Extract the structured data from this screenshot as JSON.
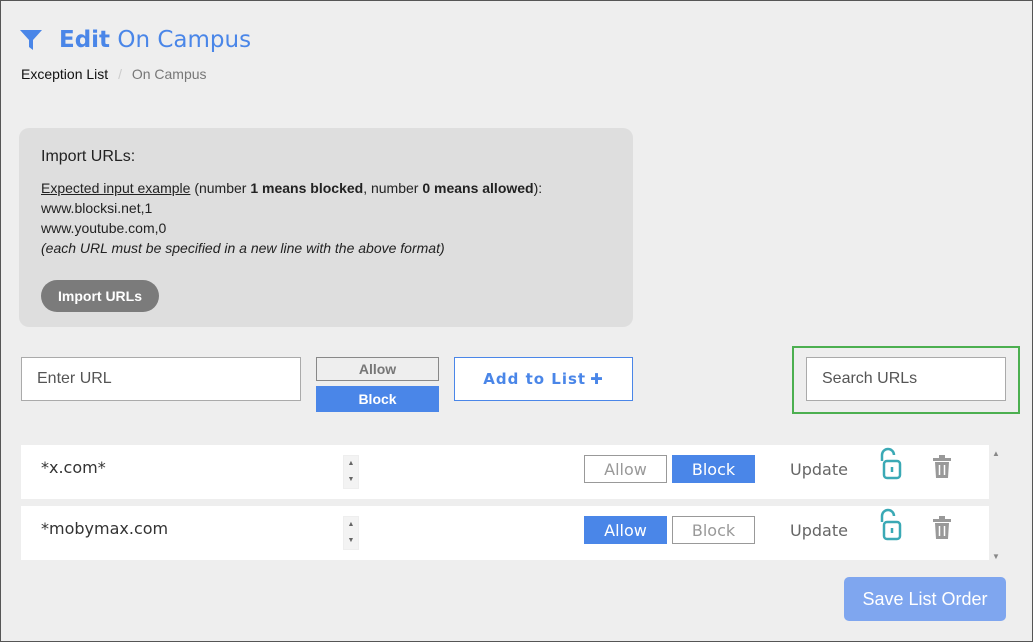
{
  "header": {
    "title_bold": "Edit",
    "title_rest": "On Campus"
  },
  "breadcrumb": {
    "items": [
      "Exception List",
      "On Campus"
    ],
    "separator": "/"
  },
  "import": {
    "title": "Import URLs:",
    "example_link": "Expected input example",
    "desc_1": " (number ",
    "desc_blocked": "1 means blocked",
    "desc_2": ", number ",
    "desc_allowed": "0 means allowed",
    "desc_3": "):",
    "example_line_1": "www.blocksi.net,1",
    "example_line_2": "www.youtube.com,0",
    "note": "(each URL must be specified in a new line with the above format)",
    "button_label": "Import URLs"
  },
  "add_form": {
    "url_placeholder": "Enter URL",
    "allow_label": "Allow",
    "block_label": "Block",
    "add_label": "Add to List"
  },
  "search": {
    "placeholder": "Search URLs"
  },
  "rows": [
    {
      "url": "*x.com*",
      "allow_label": "Allow",
      "block_label": "Block",
      "state": "Block",
      "update_label": "Update"
    },
    {
      "url": "*mobymax.com",
      "allow_label": "Allow",
      "block_label": "Block",
      "state": "Allow",
      "update_label": "Update"
    }
  ],
  "save_label": "Save List Order",
  "colors": {
    "accent": "#4a86e8",
    "search_highlight": "#4caf50",
    "lock_icon": "#3aa9b5"
  },
  "icons": {
    "header": "filter-icon",
    "row_lock": "unlock-icon",
    "row_delete": "trash-icon",
    "add": "plus-icon"
  }
}
